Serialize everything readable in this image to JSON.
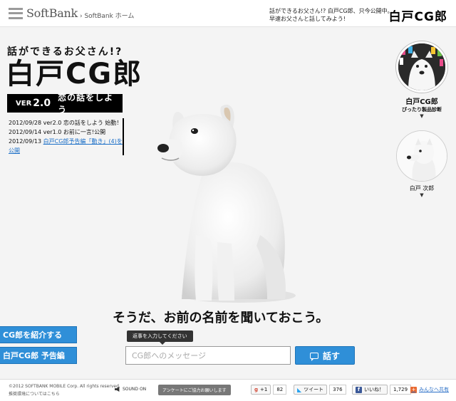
{
  "header": {
    "logo_text": "SoftBank",
    "home_link": "› SoftBank ホーム",
    "promo_line1": "話ができるお父さん!? 白戸CG郎、只今公開中。",
    "promo_line2": "早速お父さんと話してみよう!",
    "brand": "白戸CG郎"
  },
  "hero": {
    "tagline": "話ができるお父さん!?",
    "brand": "白戸CG郎",
    "version_prefix": "VER",
    "version_number": "2.0",
    "version_title": "恋の話をしよう"
  },
  "news": [
    {
      "text": "2012/09/28 ver2.0 恋の話をしよう 始動！",
      "link": ""
    },
    {
      "text": "2012/09/14 ver1.0 お前に一言!公開",
      "link": ""
    },
    {
      "text": "2012/09/13 ",
      "link": "白戸CG郎予告編「動き」(4)を"
    },
    {
      "text": "",
      "link": "公開"
    }
  ],
  "main": {
    "caption": "そうだ、お前の名前を聞いておこう。",
    "input_hint": "返事を入力してください",
    "input_placeholder": "CG郎へのメッセージ",
    "talk_button": "話す"
  },
  "left_buttons": {
    "introduce": "CG郎を紹介する",
    "trailer": "白戸CG郎 予告編"
  },
  "characters": [
    {
      "name": "白戸CG郎",
      "sub": "ぴったり製品診断"
    },
    {
      "name": "白戸 次郎",
      "sub": ""
    }
  ],
  "footer": {
    "copyright_line1": "©2012 SOFTBANK MOBILE Corp. All rights reserved.",
    "copyright_line2": "推奨環境についてはこちら",
    "sound": "SOUND ON",
    "survey": "アンケートにご協力お願いします",
    "gplus_label": "+1",
    "gplus_count": "82",
    "tweet_label": "ツイート",
    "tweet_count": "376",
    "like_label": "いいね！",
    "like_count": "1,729",
    "mixi_label": "みんなへ共有"
  },
  "colors": {
    "accent_blue": "#2f8fd8",
    "bar_black": "#000000",
    "link_blue": "#1a6ec7"
  }
}
